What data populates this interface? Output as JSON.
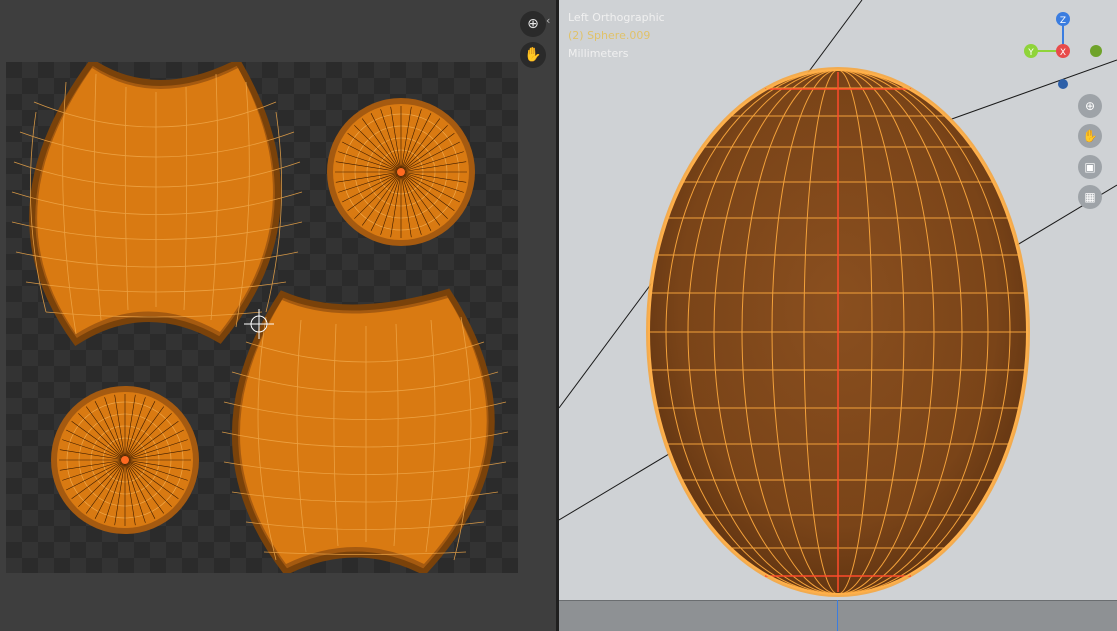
{
  "uv_editor": {
    "zoom_icon": "zoom-in-icon",
    "pan_icon": "hand-icon",
    "collapse_icon": "chevron-left-icon"
  },
  "viewport": {
    "view_name": "Left Orthographic",
    "object_label": "(2) Sphere.009",
    "units": "Millimeters",
    "gizmo": {
      "z_label": "Z",
      "y_label": "Y",
      "x_label": "X",
      "z_color": "#3b7de0",
      "y_color": "#8fd43a",
      "x_color": "#e84b4b"
    },
    "tools": [
      "zoom-in-icon",
      "hand-icon",
      "camera-icon",
      "grid-icon"
    ]
  },
  "colors": {
    "mesh_orange": "#d97a12",
    "edge_orange": "#ffb04a",
    "seam_red": "#ff4b2b",
    "uv_vertex": "#ff5a8a"
  }
}
